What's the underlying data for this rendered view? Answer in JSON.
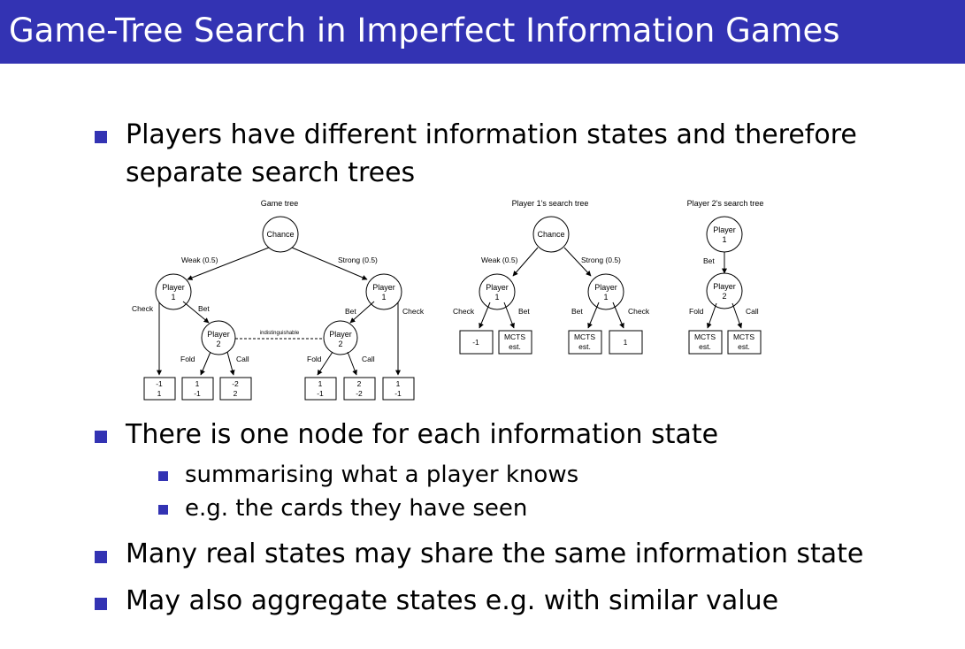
{
  "slide": {
    "title": "Game-Tree Search in Imperfect Information Games",
    "bullets": {
      "b1_line1": "Players have different information states and therefore",
      "b1_line2": "separate search trees",
      "b2": "There is one node for each information state",
      "b2_sub1": "summarising what a player knows",
      "b2_sub2": "e.g. the cards they have seen",
      "b3": "Many real states may share the same information state",
      "b4": "May also aggregate states e.g. with similar value"
    }
  },
  "colors": {
    "accent": "#3333b3",
    "title_text": "#ffffff"
  },
  "figure": {
    "game_tree": {
      "title": "Game tree",
      "chance": "Chance",
      "weak": "Weak (0.5)",
      "strong": "Strong (0.5)",
      "p1_line1": "Player",
      "p1_line2": "1",
      "p2_line1": "Player",
      "p2_line2": "2",
      "check": "Check",
      "bet": "Bet",
      "fold": "Fold",
      "call": "Call",
      "indist": "indistinguishable",
      "leaves": [
        [
          "-1",
          "1"
        ],
        [
          "1",
          "-1"
        ],
        [
          "-2",
          "2"
        ],
        [
          "1",
          "-1"
        ],
        [
          "2",
          "-2"
        ],
        [
          "1",
          "-1"
        ]
      ]
    },
    "p1_tree": {
      "title": "Player 1's search tree",
      "chance": "Chance",
      "weak": "Weak (0.5)",
      "strong": "Strong (0.5)",
      "p1_line1": "Player",
      "p1_line2": "1",
      "check": "Check",
      "bet": "Bet",
      "leaf_a": "-1",
      "mcts_line1": "MCTS",
      "mcts_line2": "est.",
      "leaf_d": "1"
    },
    "p2_tree": {
      "title": "Player 2's search tree",
      "p1_line1": "Player",
      "p1_line2": "1",
      "bet": "Bet",
      "p2_line1": "Player",
      "p2_line2": "2",
      "fold": "Fold",
      "call": "Call",
      "mcts_line1": "MCTS",
      "mcts_line2": "est."
    }
  }
}
